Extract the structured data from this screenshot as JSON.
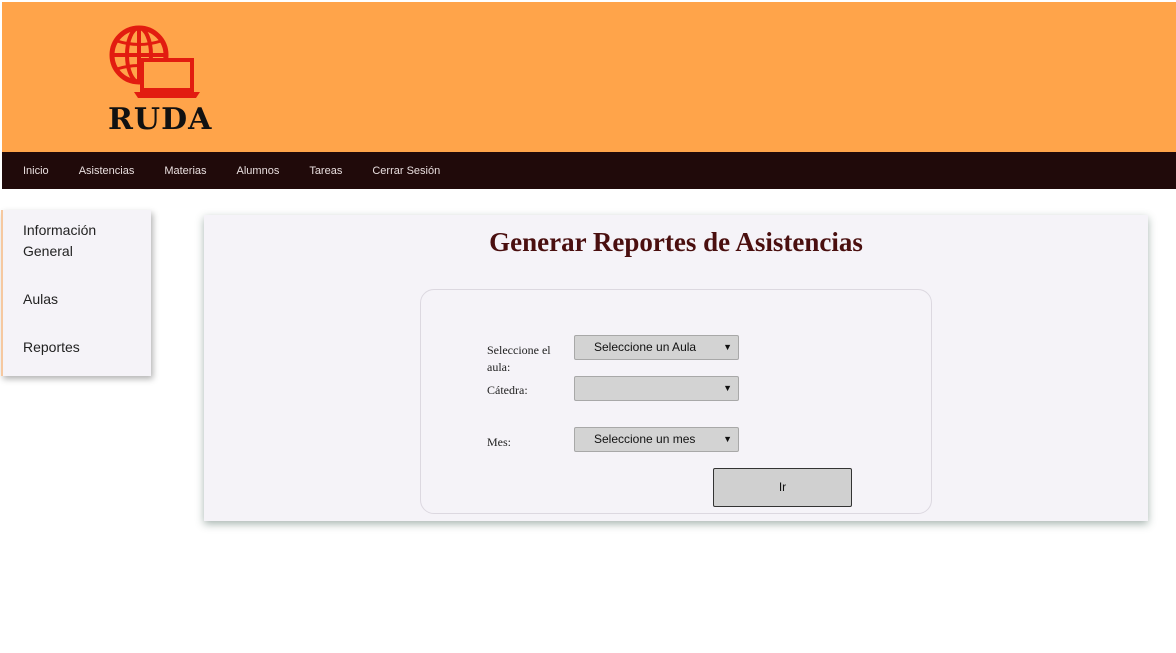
{
  "header": {
    "logo_text": "RUDA",
    "colors": {
      "background": "#ffa44a",
      "logo_red": "#e21c10"
    }
  },
  "nav": {
    "items": [
      {
        "label": "Inicio"
      },
      {
        "label": "Asistencias"
      },
      {
        "label": "Materias"
      },
      {
        "label": "Alumnos"
      },
      {
        "label": "Tareas"
      },
      {
        "label": "Cerrar Sesión"
      }
    ],
    "background": "#200a0a"
  },
  "sidebar": {
    "items": [
      {
        "label_line1": "Información",
        "label_line2": "General"
      },
      {
        "label": "Aulas"
      },
      {
        "label": "Reportes"
      }
    ]
  },
  "main": {
    "title": "Generar Reportes de Asistencias",
    "form": {
      "aula_label_line1": "Seleccione el",
      "aula_label_line2": "aula:",
      "aula_select_value": "Seleccione un Aula",
      "catedra_label": "Cátedra:",
      "catedra_select_value": "",
      "mes_label": "Mes:",
      "mes_select_value": "Seleccione un mes",
      "submit_label": "Ir"
    },
    "title_color": "#4a0f0f"
  }
}
